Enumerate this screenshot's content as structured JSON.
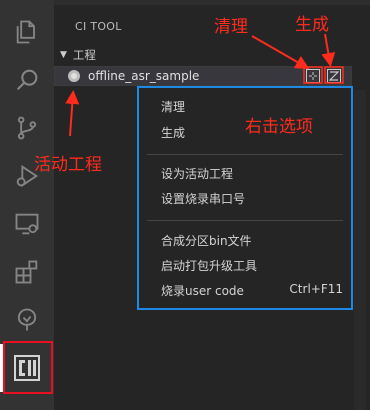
{
  "activity_bar": {
    "items": [
      "explorer-icon",
      "search-icon",
      "source-control-icon",
      "run-debug-icon",
      "remote-explorer-icon",
      "extensions-icon",
      "ci-tool-tree-icon",
      "ci-tool-logo"
    ]
  },
  "sidebar": {
    "panel_title": "CI TOOL",
    "section_label": "工程",
    "project_name": "offline_asr_sample"
  },
  "context_menu": {
    "items": [
      {
        "label": "清理",
        "shortcut": ""
      },
      {
        "label": "生成",
        "shortcut": ""
      },
      {
        "label": "设为活动工程",
        "shortcut": ""
      },
      {
        "label": "设置烧录串口号",
        "shortcut": ""
      },
      {
        "label": "合成分区bin文件",
        "shortcut": ""
      },
      {
        "label": "启动打包升级工具",
        "shortcut": ""
      },
      {
        "label": "烧录user code",
        "shortcut": "Ctrl+F11"
      }
    ]
  },
  "annotations": {
    "clean": "清理",
    "build": "生成",
    "active_project": "活动工程",
    "right_click_options": "右击选项"
  },
  "colors": {
    "annotation": "#ff2b1c",
    "menu_border": "#1e88e5",
    "highlight_border": "#e81123"
  }
}
